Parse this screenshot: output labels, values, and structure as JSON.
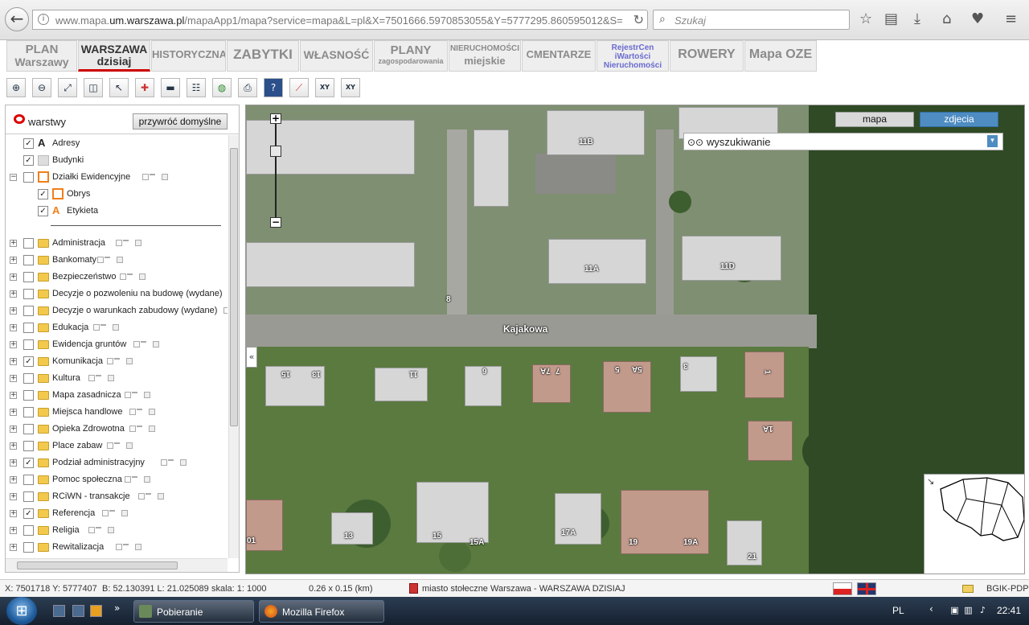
{
  "browser": {
    "url_prefix": "www.mapa.",
    "url_domain": "um.warszawa.pl",
    "url_rest": "/mapaApp1/mapa?service=mapa&L=pl&X=7501666.5970853055&Y=5777295.860595012&S=9&O=0&",
    "search_placeholder": "Szukaj"
  },
  "menu": {
    "tabs": [
      {
        "l1": "PLAN",
        "l2": "Warszawy"
      },
      {
        "l1": "WARSZAWA",
        "l2": "dzisiaj"
      },
      {
        "l1": "HISTORYCZNA",
        "l2": ""
      },
      {
        "l1": "ZABYTKI",
        "l2": ""
      },
      {
        "l1": "WŁASNOŚĆ",
        "l2": ""
      },
      {
        "l1": "PLANY",
        "l2": "zagospodarowania"
      },
      {
        "l1": "NIERUCHOMOŚCI",
        "l2": "miejskie"
      },
      {
        "l1": "CMENTARZE",
        "l2": ""
      },
      {
        "l1": "RejestrCen",
        "l2": "iWartości",
        "l3": "Nieruchomości"
      },
      {
        "l1": "ROWERY",
        "l2": ""
      },
      {
        "l1": "Mapa OZE",
        "l2": ""
      }
    ]
  },
  "toolbar": {
    "tools": [
      "zoom-in",
      "zoom-out",
      "full-extent",
      "zoom-window",
      "select",
      "add-point",
      "measure",
      "legend",
      "globe",
      "print",
      "help",
      "profile",
      "xy-goto",
      "xy-show"
    ],
    "xy_label": "XY"
  },
  "layers": {
    "title": "warstwy",
    "restore_label": "przywróć domyślne",
    "items": [
      {
        "label": "Adresy",
        "checked": true,
        "kind": "text-sym",
        "indent": 0,
        "expander": ""
      },
      {
        "label": "Budynki",
        "checked": true,
        "kind": "gray-sym",
        "indent": 0,
        "expander": ""
      },
      {
        "label": "Działki Ewidencyjne",
        "checked": false,
        "kind": "orange-box",
        "indent": 0,
        "expander": "−"
      },
      {
        "label": "Obrys",
        "checked": true,
        "kind": "orange-box",
        "indent": 1,
        "expander": ""
      },
      {
        "label": "Etykieta",
        "checked": true,
        "kind": "orange-text",
        "indent": 1,
        "expander": ""
      },
      {
        "label": "Administracja",
        "checked": false,
        "kind": "folder",
        "indent": 0,
        "expander": "+"
      },
      {
        "label": "Bankomaty",
        "checked": false,
        "kind": "folder",
        "indent": 0,
        "expander": "+"
      },
      {
        "label": "Bezpieczeństwo",
        "checked": false,
        "kind": "folder",
        "indent": 0,
        "expander": "+"
      },
      {
        "label": "Decyzje o pozwoleniu na budowę (wydane)",
        "checked": false,
        "kind": "folder",
        "indent": 0,
        "expander": "+"
      },
      {
        "label": "Decyzje o warunkach zabudowy (wydane)",
        "checked": false,
        "kind": "folder",
        "indent": 0,
        "expander": "+"
      },
      {
        "label": "Edukacja",
        "checked": false,
        "kind": "folder",
        "indent": 0,
        "expander": "+"
      },
      {
        "label": "Ewidencja gruntów",
        "checked": false,
        "kind": "folder",
        "indent": 0,
        "expander": "+"
      },
      {
        "label": "Komunikacja",
        "checked": true,
        "kind": "folder",
        "indent": 0,
        "expander": "+"
      },
      {
        "label": "Kultura",
        "checked": false,
        "kind": "folder",
        "indent": 0,
        "expander": "+"
      },
      {
        "label": "Mapa zasadnicza",
        "checked": false,
        "kind": "folder",
        "indent": 0,
        "expander": "+"
      },
      {
        "label": "Miejsca handlowe",
        "checked": false,
        "kind": "folder",
        "indent": 0,
        "expander": "+"
      },
      {
        "label": "Opieka Zdrowotna",
        "checked": false,
        "kind": "folder",
        "indent": 0,
        "expander": "+"
      },
      {
        "label": "Place zabaw",
        "checked": false,
        "kind": "folder",
        "indent": 0,
        "expander": "+"
      },
      {
        "label": "Podział administracyjny",
        "checked": true,
        "kind": "folder",
        "indent": 0,
        "expander": "+"
      },
      {
        "label": "Pomoc społeczna",
        "checked": false,
        "kind": "folder",
        "indent": 0,
        "expander": "+"
      },
      {
        "label": "RCiWN - transakcje",
        "checked": false,
        "kind": "folder",
        "indent": 0,
        "expander": "+"
      },
      {
        "label": "Referencja",
        "checked": true,
        "kind": "folder",
        "indent": 0,
        "expander": "+"
      },
      {
        "label": "Religia",
        "checked": false,
        "kind": "folder",
        "indent": 0,
        "expander": "+"
      },
      {
        "label": "Rewitalizacja",
        "checked": false,
        "kind": "folder",
        "indent": 0,
        "expander": "+"
      }
    ]
  },
  "map": {
    "btn_mapa": "mapa",
    "btn_zdjecia": "zdjecia",
    "search_title": "wyszukiwanie",
    "street_name": "Kajakowa",
    "house_numbers": [
      "11B",
      "11A",
      "11D",
      "8",
      "15",
      "13",
      "11",
      "9",
      "7",
      "7A",
      "5",
      "5A",
      "3",
      "1",
      "1A",
      "13",
      "15",
      "15A",
      "17A",
      "19",
      "19A",
      "21",
      "01"
    ]
  },
  "status": {
    "xy": "X: 7501718 Y: 5777407",
    "bl": "B: 52.130391 L: 21.025089",
    "scale": "skala: 1: 1000",
    "extent": "0.26 x 0.15 (km)",
    "district": "miasto stołeczne Warszawa - WARSZAWA DZISIAJ",
    "source": "BGIK-PDP"
  },
  "taskbar": {
    "items": [
      {
        "label": "Pobieranie"
      },
      {
        "label": "Mozilla Firefox"
      }
    ],
    "lang": "PL",
    "time": "22:41"
  }
}
